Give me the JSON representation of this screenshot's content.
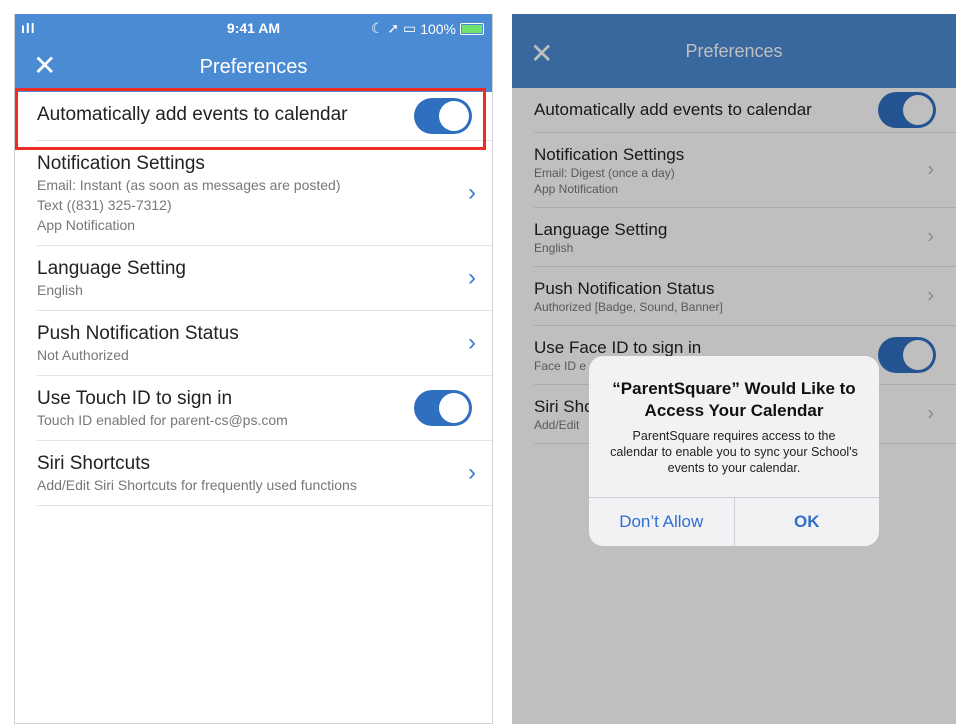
{
  "left": {
    "status": {
      "signal": "ıll",
      "time": "9:41 AM",
      "icons": "☾ ➚ ▭",
      "battery": "100%"
    },
    "title": "Preferences",
    "close_glyph": "✕",
    "rows": [
      {
        "label": "Automatically add events to calendar"
      },
      {
        "label": "Notification Settings",
        "sub": [
          "Email: Instant (as soon as messages are posted)",
          "Text ((831) 325-7312)",
          "App Notification"
        ]
      },
      {
        "label": "Language Setting",
        "sub": [
          "English"
        ]
      },
      {
        "label": "Push Notification Status",
        "sub": [
          "Not Authorized"
        ]
      },
      {
        "label": "Use Touch ID to sign in",
        "sub": [
          "Touch ID enabled for parent-cs@ps.com"
        ]
      },
      {
        "label": "Siri Shortcuts",
        "sub": [
          "Add/Edit Siri Shortcuts for frequently used functions"
        ]
      }
    ]
  },
  "right": {
    "title": "Preferences",
    "close_glyph": "✕",
    "rows": [
      {
        "label": "Automatically add events to calendar"
      },
      {
        "label": "Notification Settings",
        "sub": [
          "Email: Digest (once a day)",
          "App Notification"
        ]
      },
      {
        "label": "Language Setting",
        "sub": [
          "English"
        ]
      },
      {
        "label": "Push Notification Status",
        "sub": [
          "Authorized [Badge, Sound, Banner]"
        ]
      },
      {
        "label": "Use Face ID to sign in",
        "sub": [
          "Face ID e"
        ]
      },
      {
        "label": "Siri Sho",
        "sub": [
          "Add/Edit"
        ]
      }
    ],
    "alert": {
      "title": "“ParentSquare” Would Like to Access Your Calendar",
      "message": "ParentSquare requires access to the calendar to enable you to sync your School's events to your calendar.",
      "dont_allow": "Don’t Allow",
      "ok": "OK"
    }
  },
  "colors": {
    "accent": "#4b8bd3",
    "toggle_on": "#2f6fc0",
    "highlight": "#ee2b24"
  }
}
